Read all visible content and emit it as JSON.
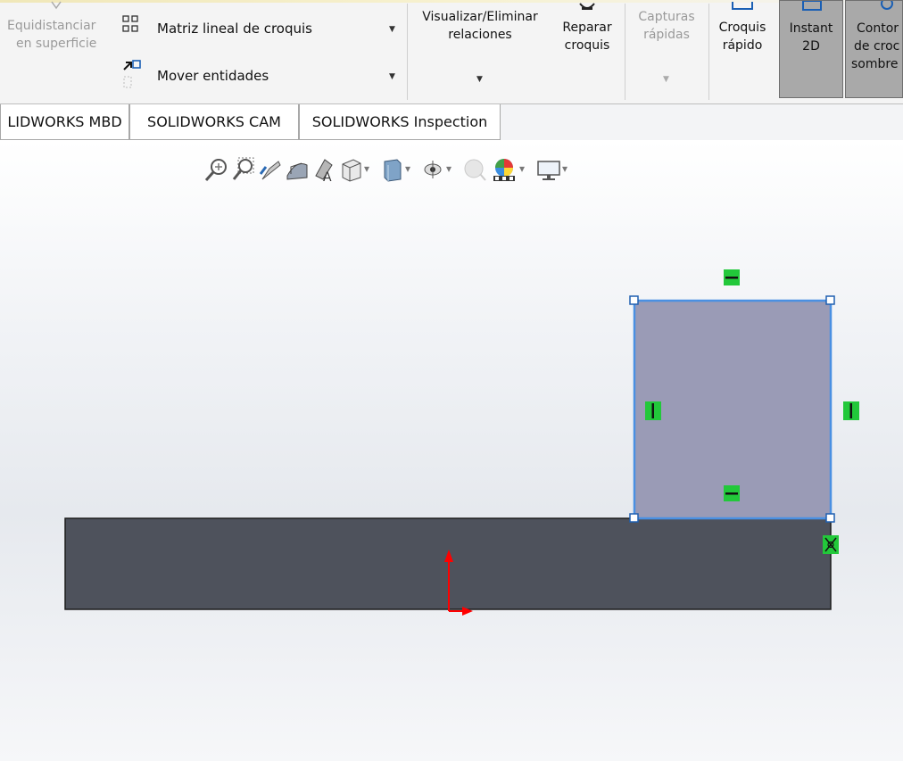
{
  "ribbon": {
    "equidistanciar_line1": "Equidistanciar",
    "equidistanciar_line2": "en superficie",
    "matriz": "Matriz lineal de croquis",
    "mover": "Mover entidades",
    "visualizar_line1": "Visualizar/Eliminar",
    "visualizar_line2": "relaciones",
    "reparar_line1": "Reparar",
    "reparar_line2": "croquis",
    "capturas_line1": "Capturas",
    "capturas_line2": "rápidas",
    "croquis_line1": "Croquis",
    "croquis_line2": "rápido",
    "instant_line1": "Instant",
    "instant_line2": "2D",
    "contorno_line1": "Contor",
    "contorno_line2": "de croc",
    "contorno_line3": "sombre"
  },
  "tabs": [
    {
      "label": "LIDWORKS MBD"
    },
    {
      "label": "SOLIDWORKS CAM"
    },
    {
      "label": "SOLIDWORKS Inspection"
    }
  ],
  "headsup_icons": [
    "zoom-to-fit-icon",
    "zoom-to-area-icon",
    "previous-view-icon",
    "section-view-icon",
    "dynamic-annotation-icon",
    "view-orientation-icon",
    "display-style-icon",
    "hide-show-items-icon",
    "edit-appearance-icon",
    "apply-scene-icon",
    "view-settings-icon"
  ],
  "colors": {
    "selection": "#4a90e2",
    "selected_fill": "#9a9bb6",
    "part_body": "#4e525c",
    "relation": "#22c83a",
    "origin": "#ff0000"
  }
}
